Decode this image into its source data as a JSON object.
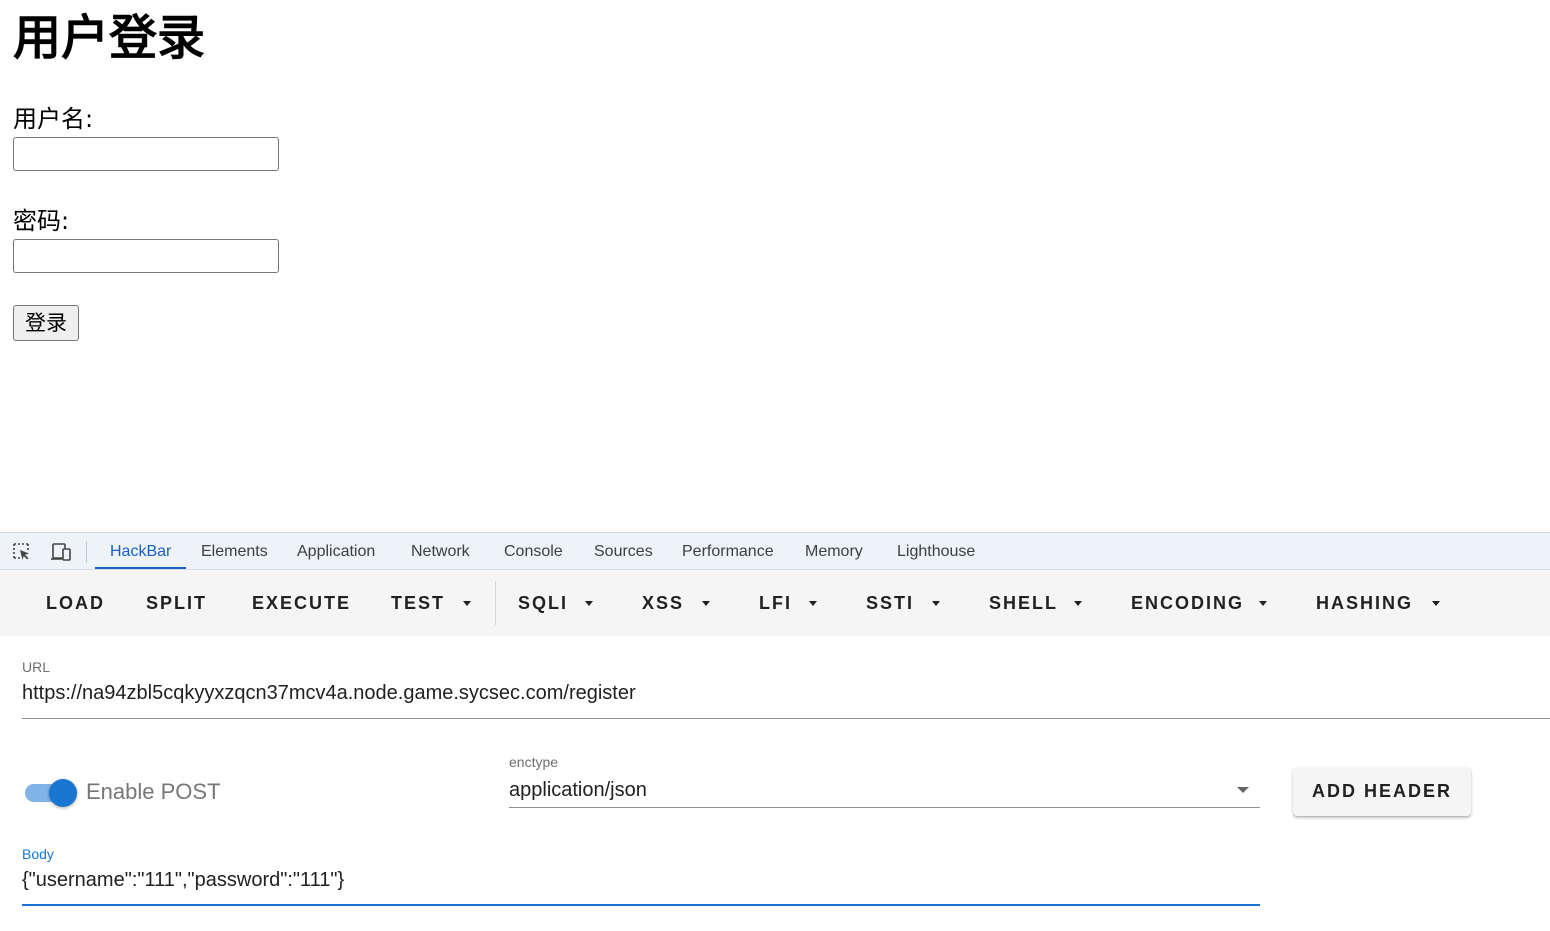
{
  "page": {
    "heading": "用户登录",
    "username_label": "用户名:",
    "password_label": "密码:",
    "username_value": "",
    "password_value": "",
    "submit_label": "登录"
  },
  "devtools": {
    "icons": [
      "inspect-element-icon",
      "device-toolbar-icon"
    ],
    "tabs": [
      {
        "label": "HackBar",
        "active": true
      },
      {
        "label": "Elements"
      },
      {
        "label": "Application"
      },
      {
        "label": "Network"
      },
      {
        "label": "Console"
      },
      {
        "label": "Sources"
      },
      {
        "label": "Performance"
      },
      {
        "label": "Memory"
      },
      {
        "label": "Lighthouse"
      }
    ],
    "accent": "#1a5fc2"
  },
  "hackbar": {
    "toolbar": [
      {
        "label": "LOAD"
      },
      {
        "label": "SPLIT"
      },
      {
        "label": "EXECUTE"
      },
      {
        "label": "TEST",
        "dropdown": true
      },
      {
        "label": "SQLI",
        "dropdown": true
      },
      {
        "label": "XSS",
        "dropdown": true
      },
      {
        "label": "LFI",
        "dropdown": true
      },
      {
        "label": "SSTI",
        "dropdown": true
      },
      {
        "label": "SHELL",
        "dropdown": true
      },
      {
        "label": "ENCODING",
        "dropdown": true
      },
      {
        "label": "HASHING",
        "dropdown": true
      }
    ],
    "url_label": "URL",
    "url_value": "https://na94zbl5cqkyyxzqcn37mcv4a.node.game.sycsec.com/register",
    "enable_post_label": "Enable POST",
    "enable_post_on": true,
    "enctype_label": "enctype",
    "enctype_value": "application/json",
    "add_header_label": "ADD HEADER",
    "body_label": "Body",
    "body_value": "{\"username\":\"111\",\"password\":\"111\"}",
    "accent": "#1976d2"
  }
}
